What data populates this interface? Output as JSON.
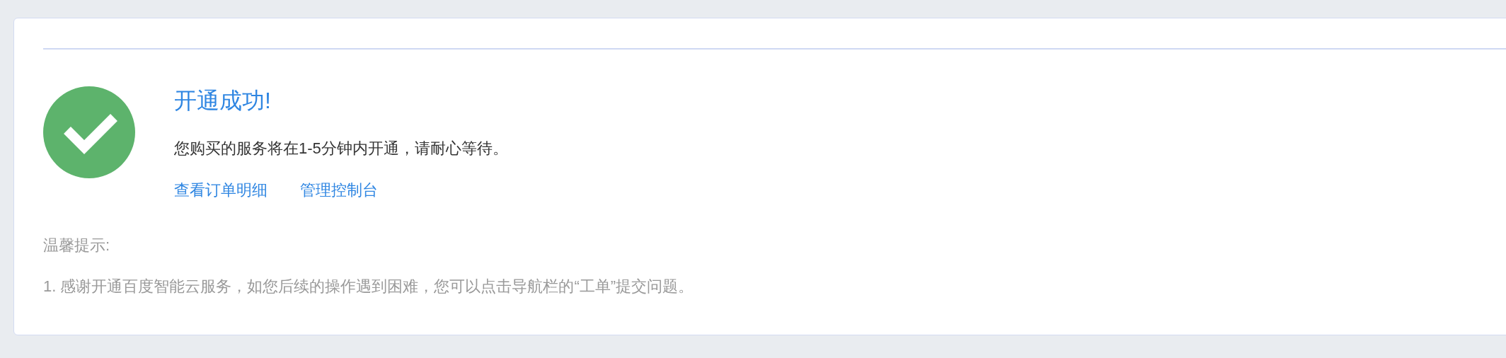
{
  "result": {
    "title": "开通成功!",
    "message": "您购买的服务将在1-5分钟内开通，请耐心等待。",
    "links": [
      "查看订单明细",
      "管理控制台"
    ]
  },
  "tips": {
    "heading": "温馨提示:",
    "items": [
      "1. 感谢开通百度智能云服务，如您后续的操作遇到困难，您可以点击导航栏的“工单”提交问题。"
    ]
  }
}
